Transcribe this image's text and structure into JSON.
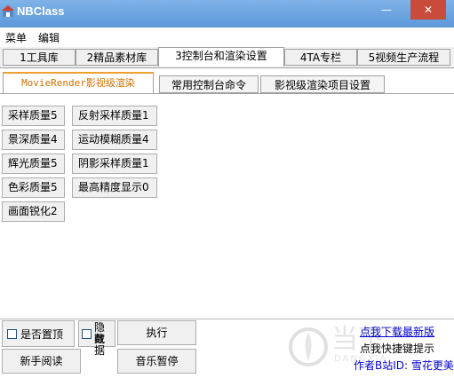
{
  "window": {
    "title": "NBClass",
    "minimize": "—",
    "close": "✕"
  },
  "menu": [
    "菜单",
    "编辑"
  ],
  "main_tabs": [
    "1工具库",
    "2精品素材库",
    "3控制台和渲染设置",
    "4TA专栏",
    "5视频生产流程"
  ],
  "sub_tabs": [
    "MovieRender影视级渲染",
    "常用控制台命令",
    "影视级渲染项目设置"
  ],
  "left_buttons": [
    "采样质量5",
    "景深质量4",
    "辉光质量5",
    "色彩质量5",
    "画面锐化2"
  ],
  "right_buttons": [
    "反射采样质量1",
    "运动模糊质量4",
    "阴影采样质量1",
    "最高精度显示0"
  ],
  "bottom": {
    "topmost_label": "是否置顶",
    "hide_data_label": [
      "隐藏",
      "数据"
    ],
    "execute": "执行",
    "beginner": "新手阅读",
    "music_pause": "音乐暂停"
  },
  "links": {
    "download": "点我下载最新版",
    "shortcut": "点我快捷键提示",
    "author": "作者B站ID: 雪花更美"
  },
  "watermark": {
    "text_cn": "当下",
    "text_en": "DANGXIA"
  }
}
